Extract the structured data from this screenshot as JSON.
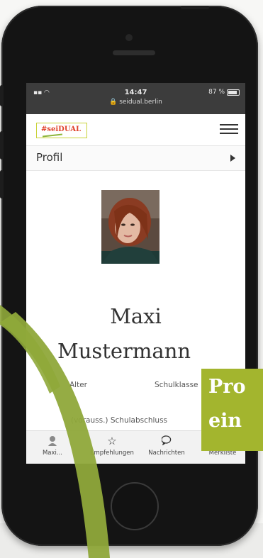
{
  "status_bar": {
    "time": "14:47",
    "url": "seidual.berlin",
    "battery": "87 %"
  },
  "app": {
    "logo_text": "#seiDUAL",
    "section_title": "Profil"
  },
  "profile": {
    "name_line1": "Maxi",
    "name_line2": "Mustermann",
    "fields": {
      "age_label": "Alter",
      "school_class_label": "Schulklasse",
      "graduation_label": "(vorauss.) Schulabschluss"
    }
  },
  "tabs": [
    {
      "label": "Maxi...",
      "icon": "avatar-icon"
    },
    {
      "label": "Empfehlungen",
      "icon": "star-icon"
    },
    {
      "label": "Nachrichten",
      "icon": "chat-bubble-icon"
    },
    {
      "label": "Merkliste",
      "icon": "pin-icon"
    }
  ],
  "callout": {
    "line1": "Pro",
    "line2": "ein"
  },
  "colors": {
    "accent_green": "#a3b52e",
    "swoosh_green": "#8fa83a",
    "logo_red": "#e0432b",
    "phone_body": "#141414"
  }
}
